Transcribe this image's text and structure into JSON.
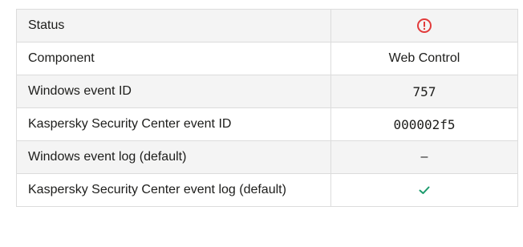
{
  "rows": [
    {
      "label": "Status",
      "value": "",
      "icon": "warning-circle-icon",
      "icon_color": "#e23b3b"
    },
    {
      "label": "Component",
      "value": "Web Control"
    },
    {
      "label": "Windows event ID",
      "value": "757"
    },
    {
      "label": "Kaspersky Security Center event ID",
      "value": "000002f5"
    },
    {
      "label": "Windows event log (default)",
      "value": "–"
    },
    {
      "label": "Kaspersky Security Center event log (default)",
      "value": "",
      "icon": "checkmark-icon",
      "icon_color": "#1a9a6c"
    }
  ],
  "colors": {
    "border": "#dcdcdc",
    "row_alt_bg": "#f4f4f4",
    "text": "#1d1d1b"
  }
}
